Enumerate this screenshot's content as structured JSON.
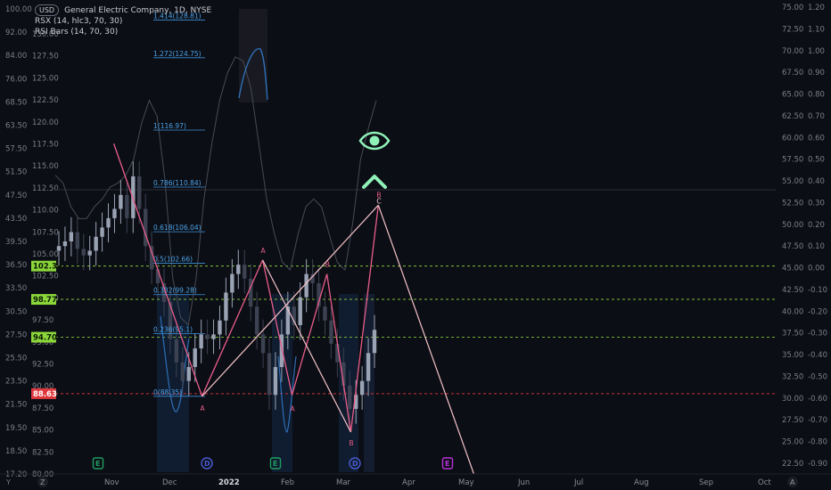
{
  "legend": {
    "currency": "USD",
    "title": "General Electric Company, 1D, NYSE",
    "indicator1": "RSX (14, hlc3, 70, 30)",
    "indicator2": "RSI Bars (14, 70, 30)"
  },
  "colors": {
    "background": "#0c0e15",
    "up_candle": "#9aa3b4",
    "down_candle": "#3c4252",
    "rsx_line": "#474b55",
    "pattern_line": "#e95d8a",
    "projection_line": "#f3c2c8",
    "fib_line": "#3d8fd6",
    "green_level": "#8bd63a",
    "red_level": "#e0373d",
    "signal_icon": "#8ff0b8"
  },
  "axis_left_outer": {
    "ticks": [
      "100.00",
      "92.00",
      "84.00",
      "76.00",
      "68.50",
      "63.50",
      "57.50",
      "51.50",
      "47.50",
      "43.50",
      "39.50",
      "36.50",
      "33.50",
      "30.50",
      "27.50",
      "25.50",
      "23.50",
      "21.50",
      "19.50",
      "18.50",
      "17.20"
    ]
  },
  "axis_left_inner": {
    "ticks": [
      "130.00",
      "127.50",
      "125.00",
      "122.50",
      "120.00",
      "117.50",
      "115.00",
      "112.50",
      "110.00",
      "107.50",
      "105.00",
      "102.50",
      "100.00",
      "97.50",
      "95.00",
      "92.50",
      "90.00",
      "87.50",
      "85.00",
      "82.50",
      "80.00"
    ]
  },
  "axis_right_outer": {
    "ticks": [
      "75.00",
      "72.50",
      "70.00",
      "67.50",
      "65.00",
      "62.50",
      "60.00",
      "57.50",
      "55.00",
      "52.50",
      "50.00",
      "47.50",
      "45.00",
      "42.50",
      "40.00",
      "37.50",
      "35.00",
      "32.50",
      "30.00",
      "27.50",
      "25.00",
      "22.50"
    ]
  },
  "axis_right_inner": {
    "ticks": [
      "1.20",
      "1.10",
      "1.00",
      "0.90",
      "0.80",
      "0.70",
      "0.60",
      "0.50",
      "0.40",
      "0.30",
      "0.20",
      "0.10",
      "0.00",
      "-0.10",
      "-0.20",
      "-0.30",
      "-0.40",
      "-0.50",
      "-0.60",
      "-0.70",
      "-0.80",
      "-0.90"
    ]
  },
  "price_labels": [
    {
      "text": "102.35",
      "color": "#8bd63a",
      "price": 102.35
    },
    {
      "text": "98.77",
      "color": "#8bd63a",
      "price": 98.77
    },
    {
      "text": "94.70",
      "color": "#8bd63a",
      "price": 94.7
    },
    {
      "text": "88.63",
      "color": "#e0373d",
      "price": 88.63
    }
  ],
  "time_axis": {
    "labels": [
      "Nov",
      "Dec",
      "2022",
      "Feb",
      "Mar",
      "Apr",
      "May",
      "Jun",
      "Jul",
      "Aug",
      "Sep",
      "Oct"
    ],
    "bold": "2022"
  },
  "events": [
    {
      "letter": "E",
      "color": "#1f9e63"
    },
    {
      "letter": "D",
      "color": "#4a5ed6"
    },
    {
      "letter": "E",
      "color": "#1f9e63"
    },
    {
      "letter": "D",
      "color": "#4a5ed6"
    },
    {
      "letter": "E",
      "color": "#b732d8"
    }
  ],
  "fib_labels": [
    "1.414(128.81)",
    "1.272(124.75)",
    "1(116.97)",
    "0.786(110.84)",
    "0.618(106.04)",
    "0.5(102.66)",
    "0.382(99.28)",
    "0.236(95.1)",
    "0(88.35)"
  ],
  "pattern_labels": [
    "A",
    "A",
    "A",
    "B",
    "B",
    "B",
    "C"
  ],
  "corners": {
    "bottom_left": "Y",
    "z_btn": "Z",
    "right_btn": "A"
  },
  "chart_data": {
    "type": "candlestick",
    "title": "General Electric Company, 1D, NYSE",
    "levels": [
      102.35,
      98.77,
      94.7,
      88.63
    ],
    "pattern_points": [
      {
        "date": "2021-10-29",
        "price": 115.5
      },
      {
        "date": "2021-12-16",
        "price": 88.35
      },
      {
        "date": "2022-01-18",
        "price": 103.0
      },
      {
        "date": "2022-02-03",
        "price": 88.5
      },
      {
        "date": "2022-02-22",
        "price": 101.5
      },
      {
        "date": "2022-03-07",
        "price": 84.5
      },
      {
        "date": "2022-03-22",
        "price": 108.9
      },
      {
        "date": "2022-05-13",
        "price": 80.0
      }
    ],
    "fib_levels": [
      {
        "ratio": "1.414",
        "price": 128.81
      },
      {
        "ratio": "1.272",
        "price": 124.75
      },
      {
        "ratio": "1",
        "price": 116.97
      },
      {
        "ratio": "0.786",
        "price": 110.84
      },
      {
        "ratio": "0.618",
        "price": 106.04
      },
      {
        "ratio": "0.5",
        "price": 102.66
      },
      {
        "ratio": "0.382",
        "price": 99.28
      },
      {
        "ratio": "0.236",
        "price": 95.1
      },
      {
        "ratio": "0",
        "price": 88.35
      }
    ],
    "rsx_series": [
      66,
      64,
      58,
      55,
      55,
      58,
      60,
      63,
      64,
      66,
      70,
      79,
      85,
      81,
      65,
      40,
      30,
      28,
      40,
      60,
      74,
      85,
      92,
      96,
      95,
      88,
      74,
      60,
      51,
      44,
      42,
      51,
      58,
      60,
      58,
      51,
      44,
      42,
      54,
      70,
      78,
      85
    ],
    "close_series": [
      104.5,
      105.0,
      106.0,
      104.2,
      103.5,
      104.0,
      105.5,
      106.5,
      107.5,
      108.5,
      110.0,
      107.5,
      112.0,
      108.5,
      104.5,
      102.0,
      100.5,
      98.5,
      94.5,
      92.0,
      90.0,
      91.5,
      93.5,
      95.0,
      94.5,
      95.0,
      96.5,
      99.5,
      101.5,
      102.5,
      101.0,
      98.0,
      95.0,
      93.0,
      88.5,
      91.5,
      95.0,
      98.0,
      96.0,
      99.0,
      101.5,
      100.5,
      98.0,
      96.5,
      94.0,
      92.0,
      89.5,
      87.0,
      88.5,
      90.0,
      93.0,
      95.5
    ]
  }
}
